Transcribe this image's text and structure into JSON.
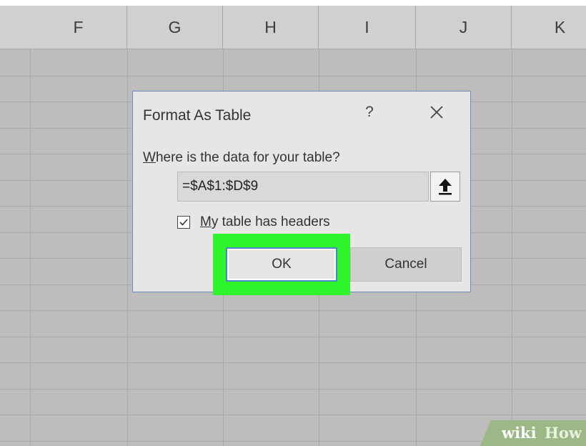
{
  "spreadsheet": {
    "columns": [
      "F",
      "G",
      "H",
      "I",
      "J",
      "K"
    ]
  },
  "dialog": {
    "title": "Format As Table",
    "help_label": "?",
    "range_prompt_accel": "W",
    "range_prompt_rest": "here is the data for your table?",
    "range_value": "=$A$1:$D$9",
    "headers_checked": true,
    "headers_label_accel": "M",
    "headers_label_rest": "y table has headers",
    "ok_label": "OK",
    "cancel_label": "Cancel",
    "icons": {
      "close": "close-icon",
      "collapse": "up-arrow-icon",
      "check": "checkmark-icon"
    }
  },
  "highlight_color": "#2ef52b",
  "watermark": {
    "part1": "wiki",
    "part2": "How"
  }
}
